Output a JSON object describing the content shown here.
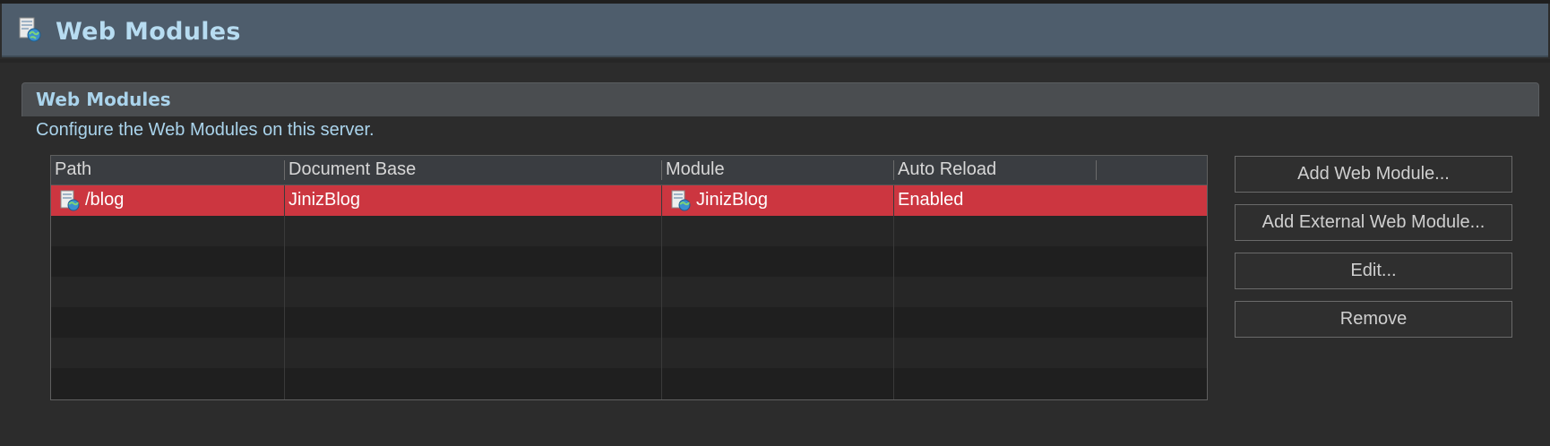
{
  "header": {
    "title": "Web Modules",
    "icon": "web-module-icon"
  },
  "section": {
    "title": "Web Modules",
    "description": "Configure the Web Modules on this server."
  },
  "table": {
    "columns": [
      "Path",
      "Document Base",
      "Module",
      "Auto Reload"
    ],
    "rows": [
      {
        "path": "/blog",
        "document_base": "JinizBlog",
        "module": "JinizBlog",
        "auto_reload": "Enabled",
        "selected": true
      }
    ]
  },
  "buttons": {
    "add_web_module": "Add Web Module...",
    "add_external_web_module": "Add External Web Module...",
    "edit": "Edit...",
    "remove": "Remove"
  },
  "colors": {
    "header_bg": "#4e5d6c",
    "header_text": "#b7dcf1",
    "selection": "#cc3640",
    "background": "#2c2c2c"
  }
}
